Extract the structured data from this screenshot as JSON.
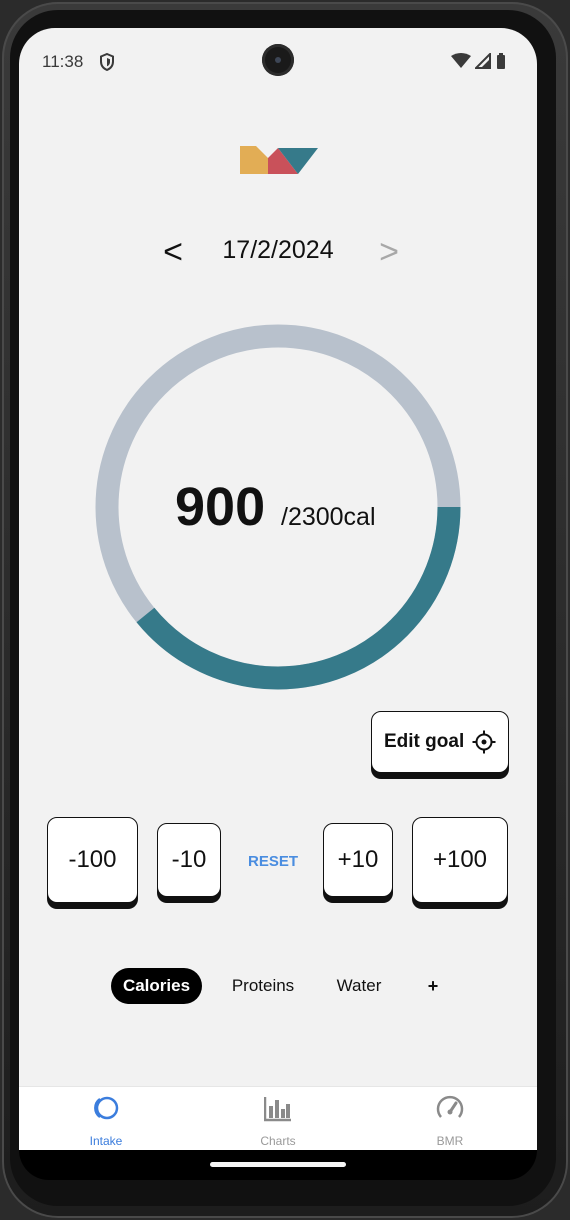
{
  "status_bar": {
    "time": "11:38"
  },
  "date_nav": {
    "prev_label": "<",
    "date": "17/2/2024",
    "next_label": ">"
  },
  "progress": {
    "value": "900",
    "goal_text": "/2300cal",
    "fraction": 0.391,
    "track_color": "#b8c1cc",
    "fill_color": "#367a8a"
  },
  "edit_goal": {
    "label": "Edit goal",
    "icon": "target-icon"
  },
  "quick_adjust": {
    "minus_100": "-100",
    "minus_10": "-10",
    "reset": "RESET",
    "plus_10": "+10",
    "plus_100": "+100"
  },
  "tracker_tabs": {
    "calories": "Calories",
    "proteins": "Proteins",
    "water": "Water",
    "add": "+"
  },
  "bottom_nav": {
    "intake": "Intake",
    "charts": "Charts",
    "bmr": "BMR",
    "active_color": "#3b7ddd"
  },
  "logo": {
    "colors": [
      "#e2ad55",
      "#c9515a",
      "#367a8a"
    ]
  }
}
